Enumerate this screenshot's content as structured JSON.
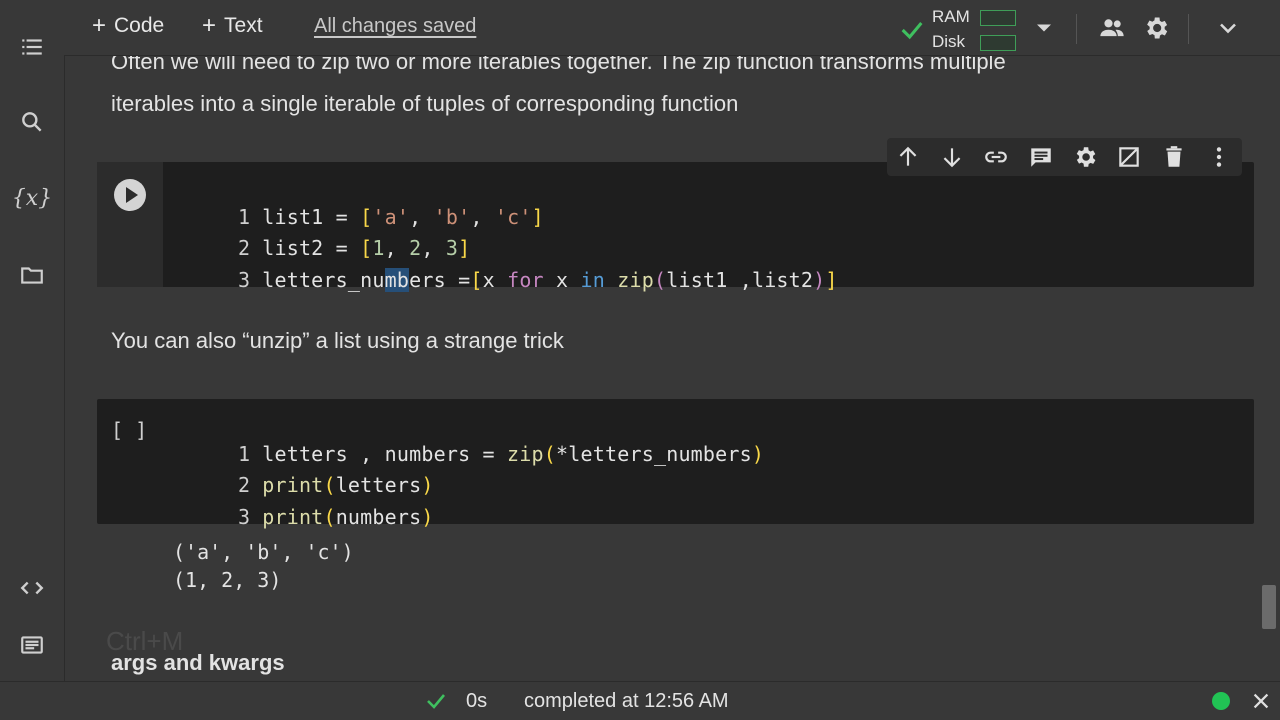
{
  "toolbar": {
    "code_label": "Code",
    "text_label": "Text",
    "save_status": "All changes saved",
    "ram_label": "RAM",
    "disk_label": "Disk"
  },
  "content": {
    "md1_line1": "Often we will need to zip two or more iterables together. The zip function transforms multiple",
    "md1_line2": "iterables into a single iterable of tuples of corresponding function",
    "md2": "You can also “unzip” a list using a strange trick",
    "heading": "args and kwargs",
    "cell2_prompt": "[ ]",
    "output_lines": [
      "('a', 'b', 'c')",
      "(1, 2, 3)"
    ],
    "shortcut_hint": "Ctrl+M"
  },
  "code_cell_1": {
    "line1": {
      "n": "1",
      "a": "list1 = ",
      "b": "[",
      "c": "'a'",
      "d": ", ",
      "e": "'b'",
      "f": ", ",
      "g": "'c'",
      "h": "]"
    },
    "line2": {
      "n": "2",
      "a": "list2 = ",
      "b": "[",
      "c": "1",
      "d": ", ",
      "e": "2",
      "f": ", ",
      "g": "3",
      "h": "]"
    },
    "line3": {
      "n": "3",
      "a": "letters_nu",
      "sel": "mb",
      "b": "ers =",
      "c": "[",
      "d": "x ",
      "e": "for",
      "f": " x ",
      "g": "in",
      "h": " ",
      "i": "zip",
      "j": "(",
      "k": "list1 ,list2",
      "l": ")",
      "m": "]"
    }
  },
  "code_cell_2": {
    "line1": {
      "n": "1",
      "a": "letters , numbers = ",
      "b": "zip",
      "c": "(",
      "d": "*letters_numbers",
      "e": ")"
    },
    "line2": {
      "n": "2",
      "a": "print",
      "b": "(",
      "c": "letters",
      "d": ")"
    },
    "line3": {
      "n": "3",
      "a": "print",
      "b": "(",
      "c": "numbers",
      "d": ")"
    }
  },
  "status": {
    "exec_time": "0s",
    "completed": "completed at 12:56 AM"
  },
  "icons": [
    "menu-icon",
    "search-icon",
    "variables-icon",
    "folder-icon",
    "code-snippets-icon",
    "terminal-icon",
    "check-icon",
    "dropdown-icon",
    "share-icon",
    "settings-icon",
    "chevron-down-icon",
    "arrow-up-icon",
    "arrow-down-icon",
    "link-icon",
    "comment-icon",
    "cell-settings-icon",
    "mirror-icon",
    "delete-icon",
    "more-vert-icon",
    "play-icon",
    "close-icon"
  ],
  "colors": {
    "accent_green": "#3fbf5f",
    "bg": "#383838",
    "cell_bg": "#1e1e1e"
  }
}
